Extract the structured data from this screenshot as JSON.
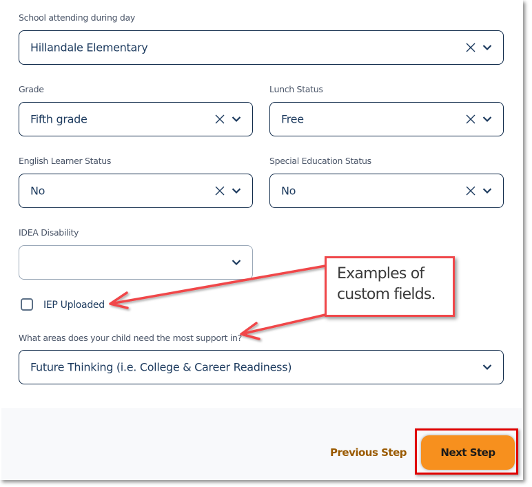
{
  "form": {
    "school": {
      "label": "School attending during day",
      "value": "Hillandale Elementary",
      "clear_icon": "close-icon",
      "dropdown_icon": "chevron-down-icon"
    },
    "grade": {
      "label": "Grade",
      "value": "Fifth grade"
    },
    "lunch_status": {
      "label": "Lunch Status",
      "value": "Free"
    },
    "english_learner_status": {
      "label": "English Learner Status",
      "value": "No"
    },
    "special_education_status": {
      "label": "Special Education Status",
      "value": "No"
    },
    "idea_disability": {
      "label": "IDEA Disability",
      "value": ""
    },
    "iep_uploaded": {
      "label": "IEP Uploaded",
      "checked": false
    },
    "support_areas": {
      "label": "What areas does your child need the most support in?",
      "required_marker": "*",
      "value": "Future Thinking (i.e. College & Career Readiness)"
    }
  },
  "footer": {
    "previous_label": "Previous Step",
    "next_label": "Next Step"
  },
  "annotation": {
    "callout_line1": "Examples of",
    "callout_line2": "custom fields."
  },
  "colors": {
    "accent_orange": "#f7901e",
    "link_brown": "#9a5a00",
    "field_border": "#0f2a4a",
    "annotation_red": "#f0474a",
    "highlight_red": "#e00000"
  }
}
